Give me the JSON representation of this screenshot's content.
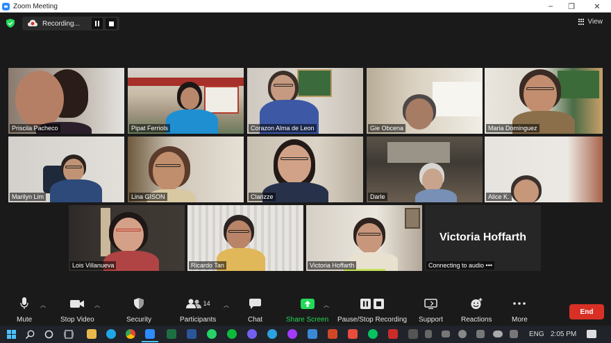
{
  "window": {
    "title": "Zoom Meeting",
    "controls": [
      "–",
      "❐",
      "✕"
    ]
  },
  "top": {
    "recording_label": "Recording...",
    "view_label": "View"
  },
  "participants": [
    {
      "name": "Priscila Pacheco"
    },
    {
      "name": "Pipat Ferriols"
    },
    {
      "name": "Corazon Alma de Leon"
    },
    {
      "name": "Gie Obcena"
    },
    {
      "name": "Maria Dominguez"
    },
    {
      "name": "Marilyn Lim"
    },
    {
      "name": "Lina GISON"
    },
    {
      "name": "Clarizze"
    },
    {
      "name": "Darle"
    },
    {
      "name": "Alice K."
    },
    {
      "name": "Lois Villanueva"
    },
    {
      "name": "Ricardo Tan"
    },
    {
      "name": "Victoria Hoffarth"
    }
  ],
  "audio_tile": {
    "display_name": "Victoria Hoffarth",
    "status": "Connecting to audio •••"
  },
  "toolbar": {
    "mute": "Mute",
    "stop_video": "Stop Video",
    "security": "Security",
    "participants": "Participants",
    "participants_count": "14",
    "chat": "Chat",
    "share_screen": "Share Screen",
    "pause_stop_recording": "Pause/Stop Recording",
    "support": "Support",
    "reactions": "Reactions",
    "more": "More",
    "end": "End"
  },
  "taskbar": {
    "language": "ENG",
    "time": "2:05 PM"
  },
  "colors": {
    "share_green": "#23d959",
    "end_red": "#d93025",
    "active_speaker": "#c4e05c",
    "zoom_blue": "#2d8cff"
  }
}
